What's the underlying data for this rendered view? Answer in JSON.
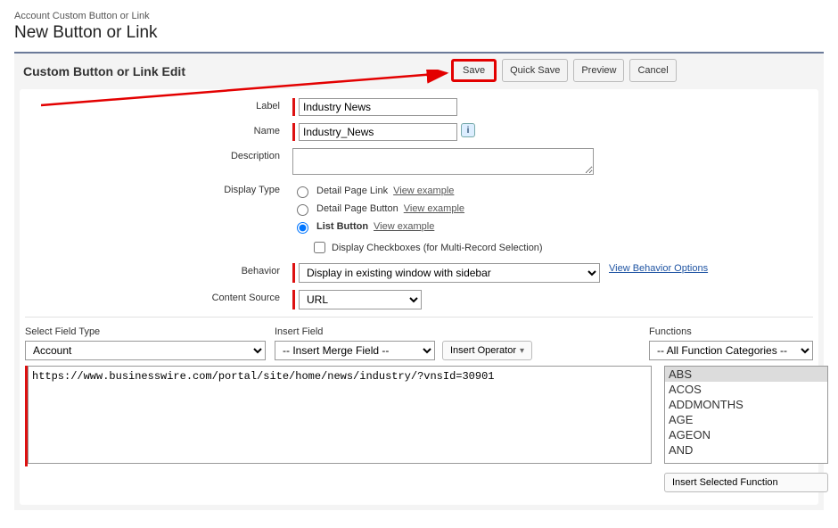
{
  "breadcrumb": "Account Custom Button or Link",
  "page_title": "New Button or Link",
  "section_title": "Custom Button or Link Edit",
  "buttons": {
    "save": "Save",
    "quick_save": "Quick Save",
    "preview": "Preview",
    "cancel": "Cancel"
  },
  "form": {
    "label_label": "Label",
    "label_value": "Industry News",
    "name_label": "Name",
    "name_value": "Industry_News",
    "description_label": "Description",
    "description_value": "",
    "display_type_label": "Display Type",
    "display_type": {
      "detail_link": "Detail Page Link",
      "detail_button": "Detail Page Button",
      "list_button": "List Button",
      "view_example": "View example",
      "checkbox_label": "Display Checkboxes (for Multi-Record Selection)",
      "selected": "list_button"
    },
    "behavior_label": "Behavior",
    "behavior_value": "Display in existing window with sidebar",
    "behavior_link": "View Behavior Options",
    "content_source_label": "Content Source",
    "content_source_value": "URL"
  },
  "editor": {
    "field_type_label": "Select Field Type",
    "field_type_value": "Account",
    "insert_field_label": "Insert Field",
    "insert_field_value": "-- Insert Merge Field --",
    "insert_operator": "Insert Operator",
    "functions_label": "Functions",
    "functions_cat_value": "-- All Function Categories --",
    "functions_list": [
      "ABS",
      "ACOS",
      "ADDMONTHS",
      "AGE",
      "AGEON",
      "AND"
    ],
    "functions_selected_index": 0,
    "insert_selected_fn": "Insert Selected Function",
    "code_value": "https://www.businesswire.com/portal/site/home/news/industry/?vnsId=30901"
  }
}
